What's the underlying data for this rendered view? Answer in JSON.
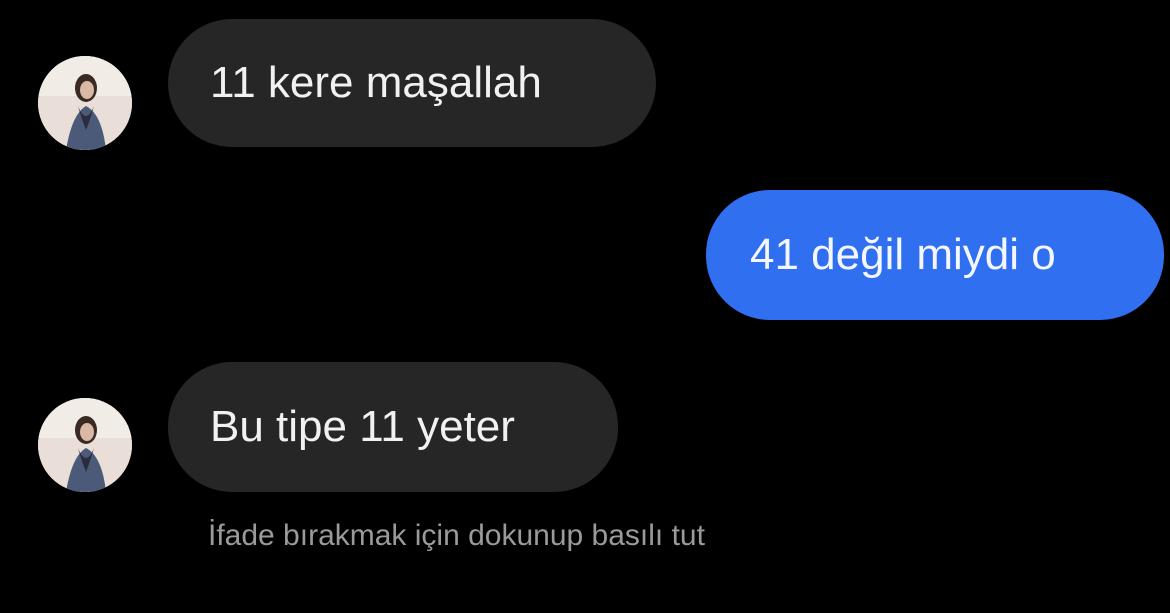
{
  "messages": [
    {
      "id": "m1",
      "direction": "incoming",
      "text": "11 kere maşallah"
    },
    {
      "id": "m2",
      "direction": "outgoing",
      "text": "41 değil miydi o"
    },
    {
      "id": "m3",
      "direction": "incoming",
      "text": "Bu tipe 11 yeter"
    }
  ],
  "reaction_hint": "İfade bırakmak için dokunup basılı tut",
  "colors": {
    "background": "#000000",
    "incoming_bubble": "#262626",
    "outgoing_bubble": "#2f6ff0",
    "hint_text": "#9a9a9a"
  }
}
